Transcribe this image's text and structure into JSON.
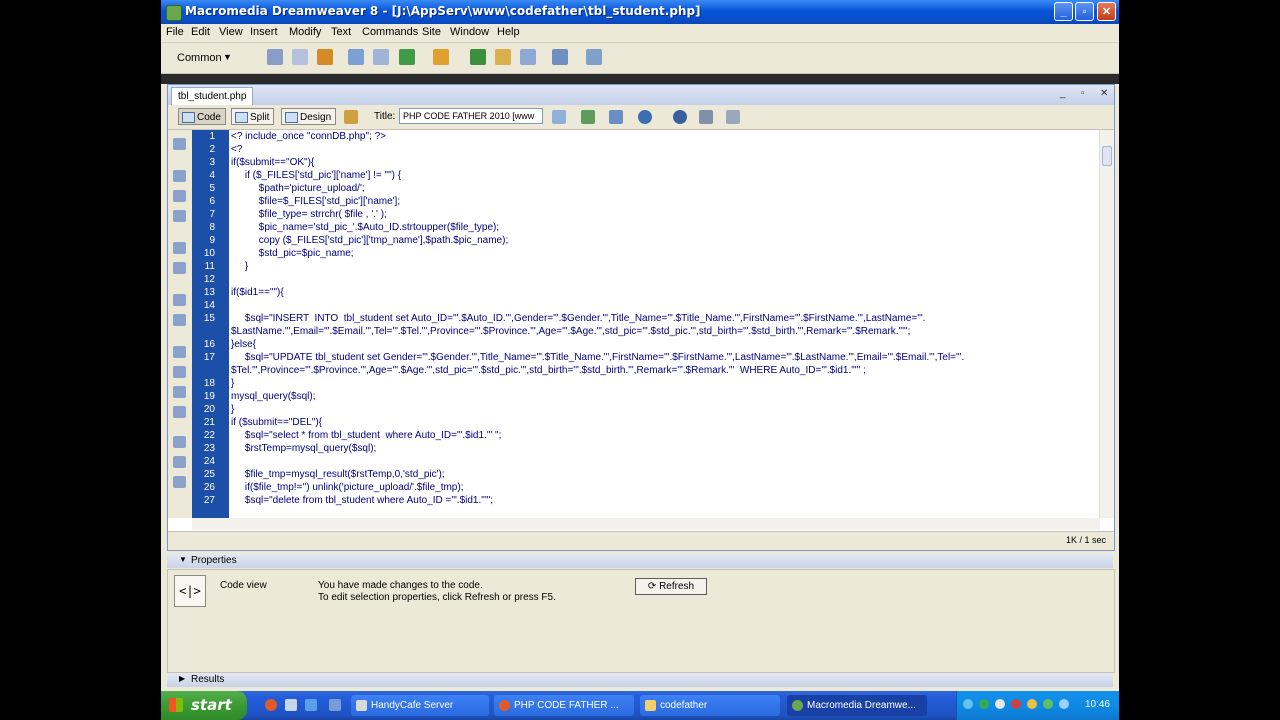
{
  "window": {
    "title": "Macromedia Dreamweaver 8 - [J:\\AppServ\\www\\codefather\\tbl_student.php]",
    "minimize": "_",
    "maximize": "▫",
    "close": "✕"
  },
  "menu": [
    "File",
    "Edit",
    "View",
    "Insert",
    "Modify",
    "Text",
    "Commands",
    "Site",
    "Window",
    "Help"
  ],
  "insert_bar": {
    "category": "Common"
  },
  "document": {
    "tab": "tbl_student.php",
    "toolbar": {
      "code": "Code",
      "split": "Split",
      "design": "Design",
      "title_label": "Title:",
      "title_value": "PHP CODE FATHER 2010 [www"
    },
    "line_numbers": [
      "1",
      "2",
      "3",
      "4",
      "5",
      "6",
      "7",
      "8",
      "9",
      "10",
      "11",
      "12",
      "13",
      "14",
      "15",
      "",
      "16",
      "17",
      "",
      "18",
      "19",
      "20",
      "21",
      "22",
      "23",
      "24",
      "25",
      "26",
      "27"
    ],
    "code_lines": [
      "<? include_once \"connDB.php\"; ?>",
      "<?",
      "if($submit==\"OK\"){",
      "     if ($_FILES['std_pic']['name'] != \"\") {",
      "          $path='picture_upload/';",
      "          $file=$_FILES['std_pic']['name'];",
      "          $file_type= strrchr( $file , '.' );",
      "          $pic_name='std_pic_'.$Auto_ID.strtoupper($file_type);",
      "          copy ($_FILES['std_pic']['tmp_name'],$path.$pic_name);",
      "          $std_pic=$pic_name;",
      "     }",
      "",
      "if($id1==\"\"){",
      "",
      "     $sql=\"INSERT  INTO  tbl_student set Auto_ID='\".$Auto_ID.\"',Gender='\".$Gender.\"',Title_Name='\".$Title_Name.\"',FirstName='\".$FirstName.\"',LastName='\".",
      "$LastName.\"',Email='\".$Email.\"',Tel='\".$Tel.\"',Province='\".$Province.\"',Age='\".$Age.\"',std_pic='\".$std_pic.\"',std_birth='\".$std_birth.\"',Remark='\".$Remark.\"'\";",
      "}else{",
      "     $sql=\"UPDATE tbl_student set Gender='\".$Gender.\"',Title_Name='\".$Title_Name.\"',FirstName='\".$FirstName.\"',LastName='\".$LastName.\"',Email='\".$Email.\"',Tel='\".",
      "$Tel.\"',Province='\".$Province.\"',Age='\".$Age.\"',std_pic='\".$std_pic.\"',std_birth='\".$std_birth.\"',Remark='\".$Remark.\"'  WHERE Auto_ID='\".$id1.\"'\" ;",
      "}",
      "mysql_query($sql);",
      "}",
      "if ($submit==\"DEL\"){",
      "     $sql=\"select * from tbl_student  where Auto_ID='\".$id1.\"' \";",
      "     $rstTemp=mysql_query($sql);",
      "",
      "     $file_tmp=mysql_result($rstTemp,0,'std_pic');",
      "     if($file_tmp!='') unlink('picture_upload/'.$file_tmp);",
      "     $sql=\"delete from tbl_student where Auto_ID ='\".$id1.\"'\";"
    ],
    "status_size": "1K / 1 sec"
  },
  "properties": {
    "header": "Properties",
    "icon_glyph": "<|>",
    "code_view_label": "Code view",
    "message_line1": "You have made changes to the code.",
    "message_line2": "To edit selection properties, click Refresh or press F5.",
    "refresh_label": "Refresh"
  },
  "results": {
    "header": "Results"
  },
  "taskbar": {
    "start": "start",
    "tasks": [
      "HandyCafe Server",
      "PHP CODE FATHER ...",
      "codefather",
      "Macromedia Dreamwe..."
    ],
    "clock": "10:46"
  },
  "colors": {
    "titlebar": "#0a4fcc",
    "gutter": "#1c4fa8",
    "code_text": "#000080",
    "taskbar": "#245edb",
    "start_button": "#3c9a33"
  }
}
